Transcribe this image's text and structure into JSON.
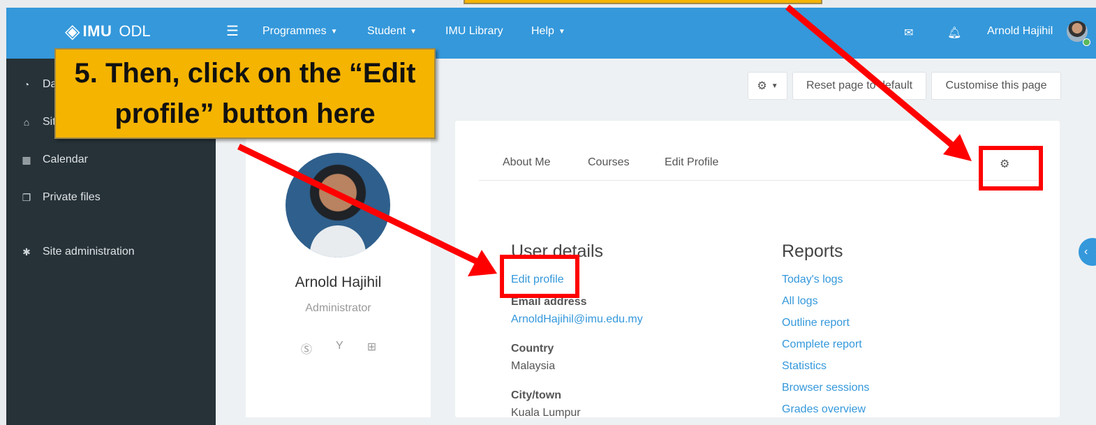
{
  "header": {
    "logo_text": "IMU",
    "logo_sub": "ODL",
    "nav": [
      "Programmes",
      "Student",
      "IMU Library",
      "Help"
    ],
    "user_name": "Arnold Hajihil"
  },
  "sidebar": {
    "items": [
      {
        "label": "Da",
        "icon": "dashboard-icon"
      },
      {
        "label": "Sit",
        "icon": "home-icon"
      },
      {
        "label": "Calendar",
        "icon": "calendar-icon"
      },
      {
        "label": "Private files",
        "icon": "files-icon"
      },
      {
        "label": "Site administration",
        "icon": "gear-icon"
      }
    ]
  },
  "page_actions": {
    "reset_label": "Reset page to default",
    "customise_label": "Customise this page"
  },
  "profile": {
    "name": "Arnold Hajihil",
    "role": "Administrator"
  },
  "tabs": [
    "About Me",
    "Courses",
    "Edit Profile"
  ],
  "user_details": {
    "title": "User details",
    "edit_link": "Edit profile",
    "email_label": "Email address",
    "email": "ArnoldHajihil@imu.edu.my",
    "country_label": "Country",
    "country": "Malaysia",
    "city_label": "City/town",
    "city": "Kuala Lumpur"
  },
  "reports": {
    "title": "Reports",
    "links": [
      "Today's logs",
      "All logs",
      "Outline report",
      "Complete report",
      "Statistics",
      "Browser sessions",
      "Grades overview"
    ]
  },
  "annotation": {
    "callout_line1": "5. Then, click on the “Edit",
    "callout_line2": "profile” button here"
  },
  "colors": {
    "header": "#3498db",
    "sidebar": "#263238",
    "callout": "#f5b400",
    "highlight": "#ff0000"
  }
}
